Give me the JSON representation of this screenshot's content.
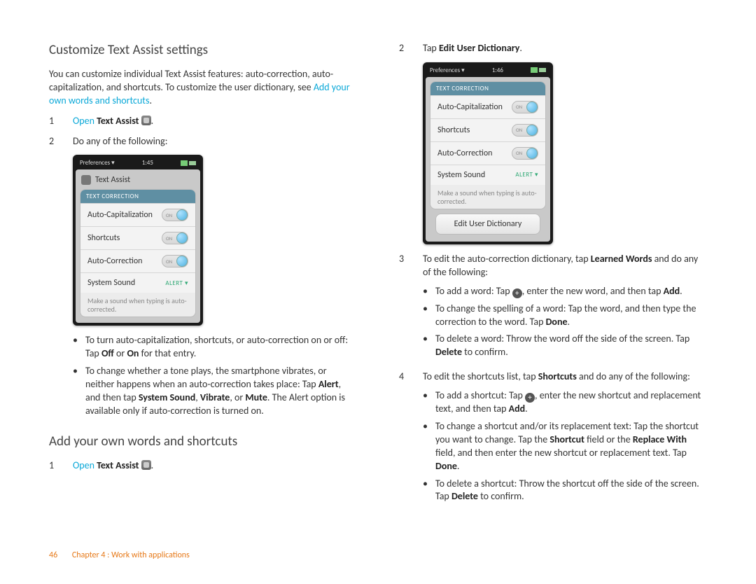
{
  "left": {
    "h1": "Customize Text Assist settings",
    "intro1": "You can customize individual Text Assist features: auto-correction, auto-capitalization, and shortcuts. To customize the user dictionary, see ",
    "intro_link": "Add your own words and shortcuts",
    "intro_tail": ".",
    "step1_open": "Open",
    "step1_app": "Text Assist",
    "step1_tail": ".",
    "step2": "Do any of the following:",
    "bullet1a": "To turn auto-capitalization, shortcuts, or auto-correction on or off: Tap ",
    "bullet1_off": "Off",
    "bullet1_or": " or ",
    "bullet1_on": "On",
    "bullet1_tail": " for that entry.",
    "bullet2a": "To change whether a tone plays, the smartphone vibrates, or neither happens when an auto-correction takes place: Tap ",
    "bullet2_alert": "Alert",
    "bullet2_b": ", and then tap ",
    "bullet2_ss": "System Sound",
    "bullet2_c": ", ",
    "bullet2_vib": "Vibrate",
    "bullet2_d": ", or ",
    "bullet2_mute": "Mute",
    "bullet2_e": ". The Alert option is available only if auto-correction is turned on.",
    "h2": "Add your own words and shortcuts",
    "h2_step1_open": "Open",
    "h2_step1_app": "Text Assist",
    "h2_step1_tail": "."
  },
  "right": {
    "step2a": "Tap ",
    "step2b": "Edit User Dictionary",
    "step2c": ".",
    "step3a": "To edit the auto-correction dictionary, tap ",
    "step3b": "Learned Words",
    "step3c": " and do any of the following:",
    "s3b1a": "To add a word: Tap ",
    "s3b1b": ", enter the new word, and then tap ",
    "s3b1c": "Add",
    "s3b1d": ".",
    "s3b2a": "To change the spelling of a word: Tap the word, and then type the correction to the word. Tap ",
    "s3b2b": "Done",
    "s3b2c": ".",
    "s3b3a": "To delete a word: Throw the word off the side of the screen. Tap ",
    "s3b3b": "Delete",
    "s3b3c": " to confirm.",
    "step4a": "To edit the shortcuts list, tap ",
    "step4b": "Shortcuts",
    "step4c": " and do any of the following:",
    "s4b1a": "To add a shortcut: Tap ",
    "s4b1b": ", enter the new shortcut and replacement text, and then tap ",
    "s4b1c": "Add",
    "s4b1d": ".",
    "s4b2a": "To change a shortcut and/or its replacement text: Tap the shortcut you want to change. Tap the ",
    "s4b2b": "Shortcut",
    "s4b2c": " field or the ",
    "s4b2d": "Replace With",
    "s4b2e": " field, and then enter the new shortcut or replacement text. Tap ",
    "s4b2f": "Done",
    "s4b2g": ".",
    "s4b3a": "To delete a shortcut: Throw the shortcut off the side of the screen. Tap ",
    "s4b3b": "Delete",
    "s4b3c": " to confirm."
  },
  "phone1": {
    "status_left": "Preferences",
    "time": "1:45",
    "title": "Text Assist",
    "section": "TEXT CORRECTION",
    "row1": "Auto-Capitalization",
    "row2": "Shortcuts",
    "row3": "Auto-Correction",
    "row4": "System Sound",
    "row4_val": "ALERT ▾",
    "note": "Make a sound when typing is auto-corrected."
  },
  "phone2": {
    "status_left": "Preferences",
    "time": "1:46",
    "section": "TEXT CORRECTION",
    "row1": "Auto-Capitalization",
    "row2": "Shortcuts",
    "row3": "Auto-Correction",
    "row4": "System Sound",
    "row4_val": "ALERT ▾",
    "note": "Make a sound when typing is auto-corrected.",
    "button": "Edit User Dictionary"
  },
  "footer": {
    "page": "46",
    "chapter": "Chapter 4 : Work with applications"
  }
}
